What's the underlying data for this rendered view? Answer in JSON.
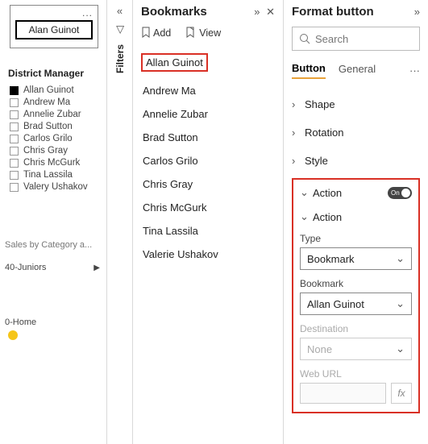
{
  "canvas": {
    "button_label": "Alan Guinot",
    "district_title": "District Manager",
    "managers": [
      {
        "label": "Allan Guinot",
        "checked": true
      },
      {
        "label": "Andrew Ma",
        "checked": false
      },
      {
        "label": "Annelie Zubar",
        "checked": false
      },
      {
        "label": "Brad Sutton",
        "checked": false
      },
      {
        "label": "Carlos Grilo",
        "checked": false
      },
      {
        "label": "Chris Gray",
        "checked": false
      },
      {
        "label": "Chris McGurk",
        "checked": false
      },
      {
        "label": "Tina Lassila",
        "checked": false
      },
      {
        "label": "Valery Ushakov",
        "checked": false
      }
    ],
    "sales_label": "Sales by Category a...",
    "juniors_label": "40-Juniors",
    "home_label": "0-Home"
  },
  "filters": {
    "label": "Filters"
  },
  "bookmarks": {
    "title": "Bookmarks",
    "add": "Add",
    "view": "View",
    "items": [
      "Allan Guinot",
      "Andrew Ma",
      "Annelie Zubar",
      "Brad Sutton",
      "Carlos Grilo",
      "Chris Gray",
      "Chris McGurk",
      "Tina Lassila",
      "Valerie Ushakov"
    ],
    "selected_index": 0
  },
  "format": {
    "title": "Format button",
    "search_placeholder": "Search",
    "tabs": {
      "button": "Button",
      "general": "General"
    },
    "sections": {
      "shape": "Shape",
      "rotation": "Rotation",
      "style": "Style"
    },
    "action": {
      "header": "Action",
      "toggle_text": "On",
      "sub_header": "Action",
      "type_label": "Type",
      "type_value": "Bookmark",
      "bookmark_label": "Bookmark",
      "bookmark_value": "Allan Guinot",
      "destination_label": "Destination",
      "destination_value": "None",
      "weburl_label": "Web URL",
      "fx": "fx"
    }
  }
}
